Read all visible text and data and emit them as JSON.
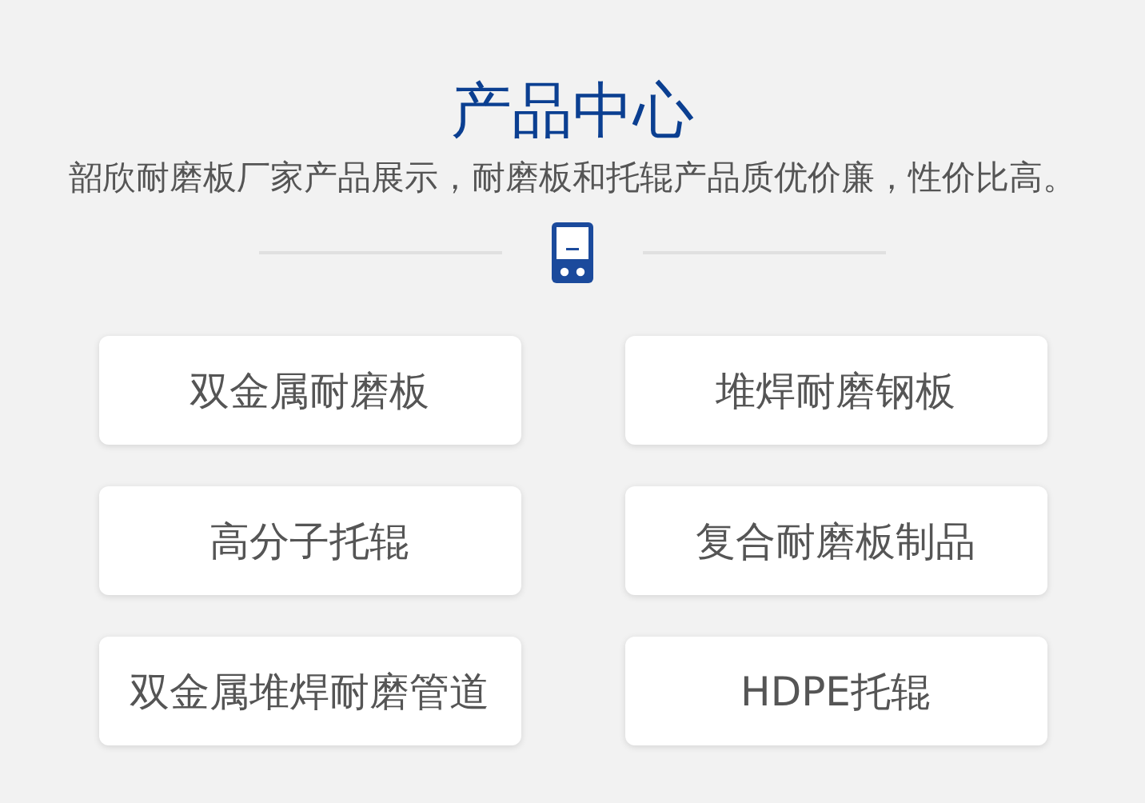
{
  "heading": {
    "title": "产品中心",
    "subtitle": "韶欣耐磨板厂家产品展示，耐磨板和托辊产品质优价廉，性价比高。"
  },
  "products": [
    {
      "label": "双金属耐磨板"
    },
    {
      "label": "堆焊耐磨钢板"
    },
    {
      "label": "高分子托辊"
    },
    {
      "label": "复合耐磨板制品"
    },
    {
      "label": "双金属堆焊耐磨管道"
    },
    {
      "label": "HDPE托辊"
    }
  ]
}
